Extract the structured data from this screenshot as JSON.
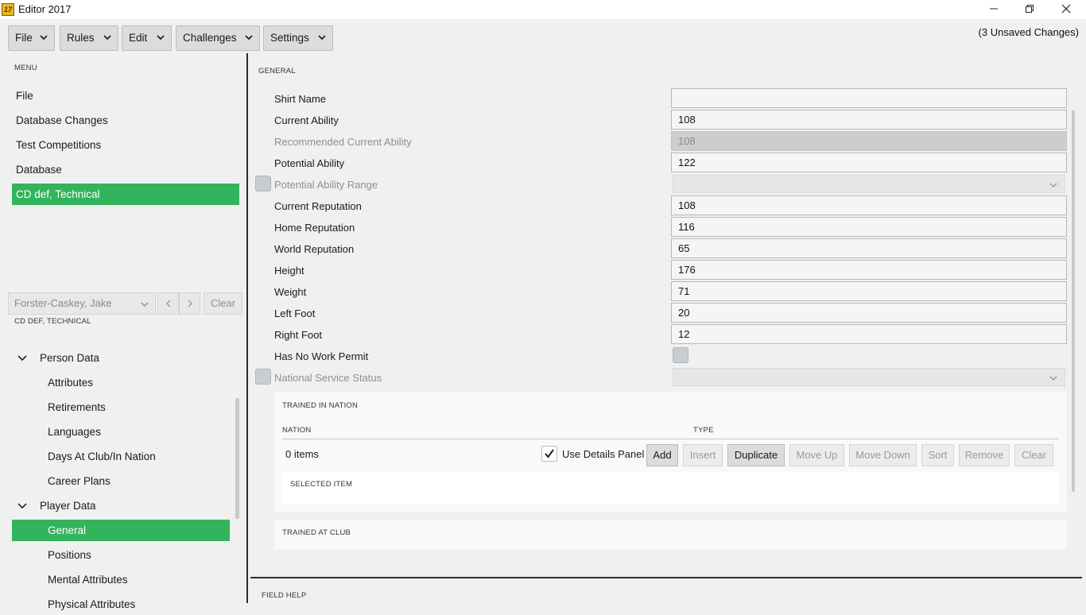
{
  "window": {
    "title": "Editor 2017",
    "app_icon_text": "17",
    "minimize_icon": "minimize-icon",
    "restore_icon": "restore-icon",
    "close_icon": "close-icon"
  },
  "top_menu": [
    {
      "label": "File"
    },
    {
      "label": "Rules"
    },
    {
      "label": "Edit"
    },
    {
      "label": "Challenges"
    },
    {
      "label": "Settings"
    }
  ],
  "unsaved_changes": "(3 Unsaved Changes)",
  "left": {
    "menu_caption": "MENU",
    "menu_items": [
      {
        "label": "File",
        "active": false
      },
      {
        "label": "Database Changes",
        "active": false
      },
      {
        "label": "Test Competitions",
        "active": false
      },
      {
        "label": "Database",
        "active": false
      },
      {
        "label": "CD def, Technical",
        "active": true
      }
    ],
    "person_picker": {
      "value": "Forster-Caskey, Jake",
      "clear_label": "Clear"
    },
    "person_caption": "CD DEF, TECHNICAL",
    "tree": {
      "person_data": {
        "label": "Person Data",
        "children": [
          "Attributes",
          "Retirements",
          "Languages",
          "Days At Club/In Nation",
          "Career Plans"
        ]
      },
      "player_data": {
        "label": "Player Data",
        "children": [
          "General",
          "Positions",
          "Mental Attributes",
          "Physical Attributes"
        ],
        "active_child": "General"
      }
    }
  },
  "general": {
    "caption": "GENERAL",
    "fields": {
      "shirt_name": {
        "label": "Shirt Name",
        "value": ""
      },
      "current_ability": {
        "label": "Current Ability",
        "value": "108"
      },
      "recommended_current_ability": {
        "label": "Recommended Current Ability",
        "value": "108"
      },
      "potential_ability": {
        "label": "Potential Ability",
        "value": "122"
      },
      "potential_ability_range": {
        "label": "Potential Ability Range"
      },
      "current_reputation": {
        "label": "Current Reputation",
        "value": "108"
      },
      "home_reputation": {
        "label": "Home Reputation",
        "value": "116"
      },
      "world_reputation": {
        "label": "World Reputation",
        "value": "65"
      },
      "height": {
        "label": "Height",
        "value": "176"
      },
      "weight": {
        "label": "Weight",
        "value": "71"
      },
      "left_foot": {
        "label": "Left Foot",
        "value": "20"
      },
      "right_foot": {
        "label": "Right Foot",
        "value": "12"
      },
      "has_no_work_permit": {
        "label": "Has No Work Permit"
      },
      "national_service_status": {
        "label": "National Service Status"
      }
    },
    "trained_in_nation": {
      "caption": "TRAINED IN NATION",
      "columns": [
        "NATION",
        "TYPE"
      ],
      "count_text": "0 items",
      "use_details_panel": {
        "label": "Use Details Panel",
        "checked": true
      },
      "buttons": {
        "add": "Add",
        "insert": "Insert",
        "duplicate": "Duplicate",
        "move_up": "Move Up",
        "move_down": "Move Down",
        "sort": "Sort",
        "remove": "Remove",
        "clear": "Clear"
      },
      "selected_item_caption": "SELECTED ITEM"
    },
    "trained_at_club": {
      "caption": "TRAINED AT CLUB"
    }
  },
  "field_help": {
    "caption": "FIELD HELP"
  }
}
